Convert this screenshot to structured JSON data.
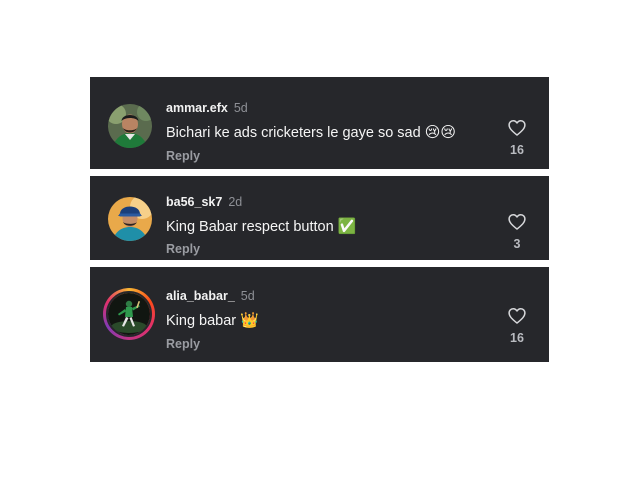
{
  "comments": [
    {
      "username": "ammar.efx",
      "age": "5d",
      "text": "Bichari ke ads cricketers le gaye so sad",
      "emojis": "😢😢",
      "reply_label": "Reply",
      "likes": "16"
    },
    {
      "username": "ba56_sk7",
      "age": "2d",
      "text": "King Babar respect button",
      "emojis": "✅",
      "reply_label": "Reply",
      "likes": "3"
    },
    {
      "username": "alia_babar_",
      "age": "5d",
      "text": "King babar",
      "emojis": "👑",
      "reply_label": "Reply",
      "likes": "16",
      "has_story_ring": true
    }
  ],
  "icons": {
    "like": "heart-outline-icon"
  },
  "colors": {
    "card_background": "#26272b",
    "username": "#f2f2f2",
    "muted": "#8e9096",
    "story_ring": "#e1306c"
  }
}
